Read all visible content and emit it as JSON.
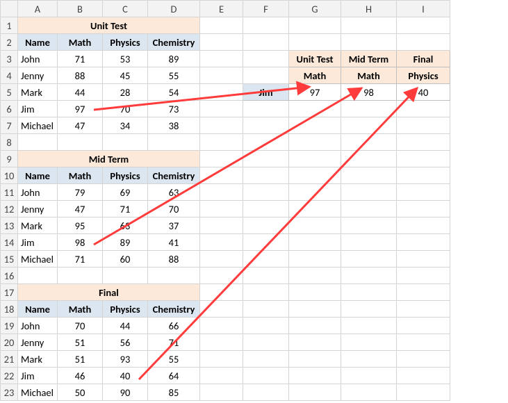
{
  "column_letters": [
    "A",
    "B",
    "C",
    "D",
    "E",
    "F",
    "G",
    "H",
    "I"
  ],
  "headers": {
    "name": "Name",
    "math": "Math",
    "physics": "Physics",
    "chemistry": "Chemistry"
  },
  "tables": {
    "unit_test": {
      "title": "Unit Test",
      "rows": [
        {
          "name": "John",
          "math": 71,
          "physics": 53,
          "chemistry": 89
        },
        {
          "name": "Jenny",
          "math": 88,
          "physics": 45,
          "chemistry": 55
        },
        {
          "name": "Mark",
          "math": 44,
          "physics": 28,
          "chemistry": 54
        },
        {
          "name": "Jim",
          "math": 97,
          "physics": 70,
          "chemistry": 73
        },
        {
          "name": "Michael",
          "math": 47,
          "physics": 34,
          "chemistry": 38
        }
      ]
    },
    "mid_term": {
      "title": "Mid Term",
      "rows": [
        {
          "name": "John",
          "math": 79,
          "physics": 69,
          "chemistry": 63
        },
        {
          "name": "Jenny",
          "math": 47,
          "physics": 71,
          "chemistry": 70
        },
        {
          "name": "Mark",
          "math": 95,
          "physics": 63,
          "chemistry": 37
        },
        {
          "name": "Jim",
          "math": 98,
          "physics": 89,
          "chemistry": 41
        },
        {
          "name": "Michael",
          "math": 71,
          "physics": 60,
          "chemistry": 88
        }
      ]
    },
    "final": {
      "title": "Final",
      "rows": [
        {
          "name": "John",
          "math": 70,
          "physics": 44,
          "chemistry": 66
        },
        {
          "name": "Jenny",
          "math": 51,
          "physics": 56,
          "chemistry": 71
        },
        {
          "name": "Mark",
          "math": 51,
          "physics": 93,
          "chemistry": 55
        },
        {
          "name": "Jim",
          "math": 46,
          "physics": 40,
          "chemistry": 64
        },
        {
          "name": "Michael",
          "math": 50,
          "physics": 90,
          "chemistry": 85
        }
      ]
    }
  },
  "lookup": {
    "col_headers": [
      "Unit Test",
      "Mid Term",
      "Final"
    ],
    "sub_headers": [
      "Math",
      "Math",
      "Physics"
    ],
    "name": "Jim",
    "values": [
      97,
      98,
      40
    ]
  }
}
